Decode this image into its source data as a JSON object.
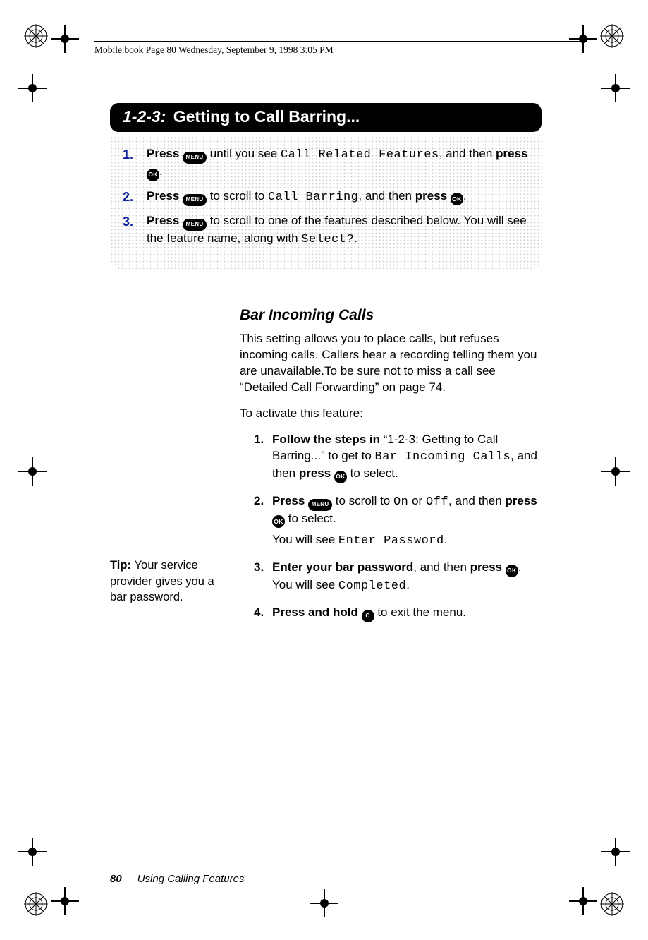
{
  "running_head": "Mobile.book  Page 80  Wednesday, September 9, 1998  3:05 PM",
  "section_title_pre": "1-2-3:",
  "section_title_rest": " Getting to Call Barring...",
  "buttons": {
    "menu": "MENU",
    "ok": "OK",
    "c": "C"
  },
  "steps": {
    "s1_a": "Press ",
    "s1_b": " until you see ",
    "s1_mono": "Call Related Features",
    "s1_c": ", and then ",
    "s1_d": "press ",
    "s1_e": ".",
    "s2_a": "Press ",
    "s2_b": " to scroll to ",
    "s2_mono": "Call Barring",
    "s2_c": ", and then ",
    "s2_d": "press ",
    "s2_e": ".",
    "s3_a": "Press ",
    "s3_b": " to scroll to one of the features described below. You will see the feature name, along with ",
    "s3_mono": "Select?",
    "s3_c": "."
  },
  "sub_heading": "Bar Incoming Calls",
  "intro_para": "This setting allows you to place calls, but refuses incoming calls. Callers hear a recording telling them you are unavailable.To be sure not to miss a call see “Detailed Call Forwarding” on page 74.",
  "activate_line": "To activate this feature:",
  "sub_steps": {
    "a1_a": "Follow the steps in ",
    "a1_b": "“1-2-3: Getting to Call Barring...” to get to ",
    "a1_mono": "Bar Incoming Calls",
    "a1_c": ", and then ",
    "a1_d": "press ",
    "a1_e": " to select.",
    "a2_a": "Press ",
    "a2_b": " to scroll to ",
    "a2_mono1": "On",
    "a2_mid": " or ",
    "a2_mono2": "Off",
    "a2_c": ", and then ",
    "a2_d": "press ",
    "a2_e": " to select.",
    "a2_see_a": "You will see ",
    "a2_see_mono": "Enter Password",
    "a2_see_b": ".",
    "a3_a": "Enter your bar password",
    "a3_b": ", and then ",
    "a3_c": "press ",
    "a3_d": ". You will see ",
    "a3_mono": "Completed",
    "a3_e": ".",
    "a4_a": "Press and hold ",
    "a4_b": " to exit the menu."
  },
  "tip_label": "Tip: ",
  "tip_text": "Your service provider gives you a bar password.",
  "footer": {
    "page_number": "80",
    "chapter": "Using Calling Features"
  }
}
